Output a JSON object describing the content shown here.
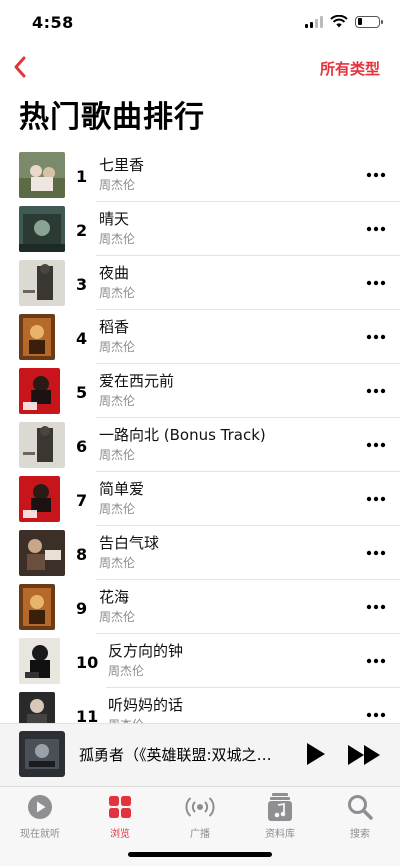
{
  "status_bar": {
    "time": "4:58"
  },
  "nav": {
    "back_icon": "chevron-left-icon",
    "action_label": "所有类型",
    "accent_color": "#e3343e"
  },
  "page": {
    "title": "热门歌曲排行"
  },
  "songs": [
    {
      "rank": "1",
      "title": "七里香",
      "artist": "周杰伦"
    },
    {
      "rank": "2",
      "title": "晴天",
      "artist": "周杰伦"
    },
    {
      "rank": "3",
      "title": "夜曲",
      "artist": "周杰伦"
    },
    {
      "rank": "4",
      "title": "稻香",
      "artist": "周杰伦"
    },
    {
      "rank": "5",
      "title": "爱在西元前",
      "artist": "周杰伦"
    },
    {
      "rank": "6",
      "title": "一路向北 (Bonus Track)",
      "artist": "周杰伦"
    },
    {
      "rank": "7",
      "title": "简单爱",
      "artist": "周杰伦"
    },
    {
      "rank": "8",
      "title": "告白气球",
      "artist": "周杰伦"
    },
    {
      "rank": "9",
      "title": "花海",
      "artist": "周杰伦"
    },
    {
      "rank": "10",
      "title": "反方向的钟",
      "artist": "周杰伦"
    },
    {
      "rank": "11",
      "title": "听妈妈的话",
      "artist": "周杰伦"
    }
  ],
  "now_playing": {
    "title": "孤勇者（《英雄联盟:双城之战》动画剧集中文主题曲）"
  },
  "tabs": [
    {
      "label": "现在就听",
      "icon": "play-circle-icon"
    },
    {
      "label": "浏览",
      "icon": "grid-icon"
    },
    {
      "label": "广播",
      "icon": "radio-icon"
    },
    {
      "label": "资料库",
      "icon": "library-icon"
    },
    {
      "label": "搜索",
      "icon": "search-icon"
    }
  ],
  "active_tab": "浏览"
}
